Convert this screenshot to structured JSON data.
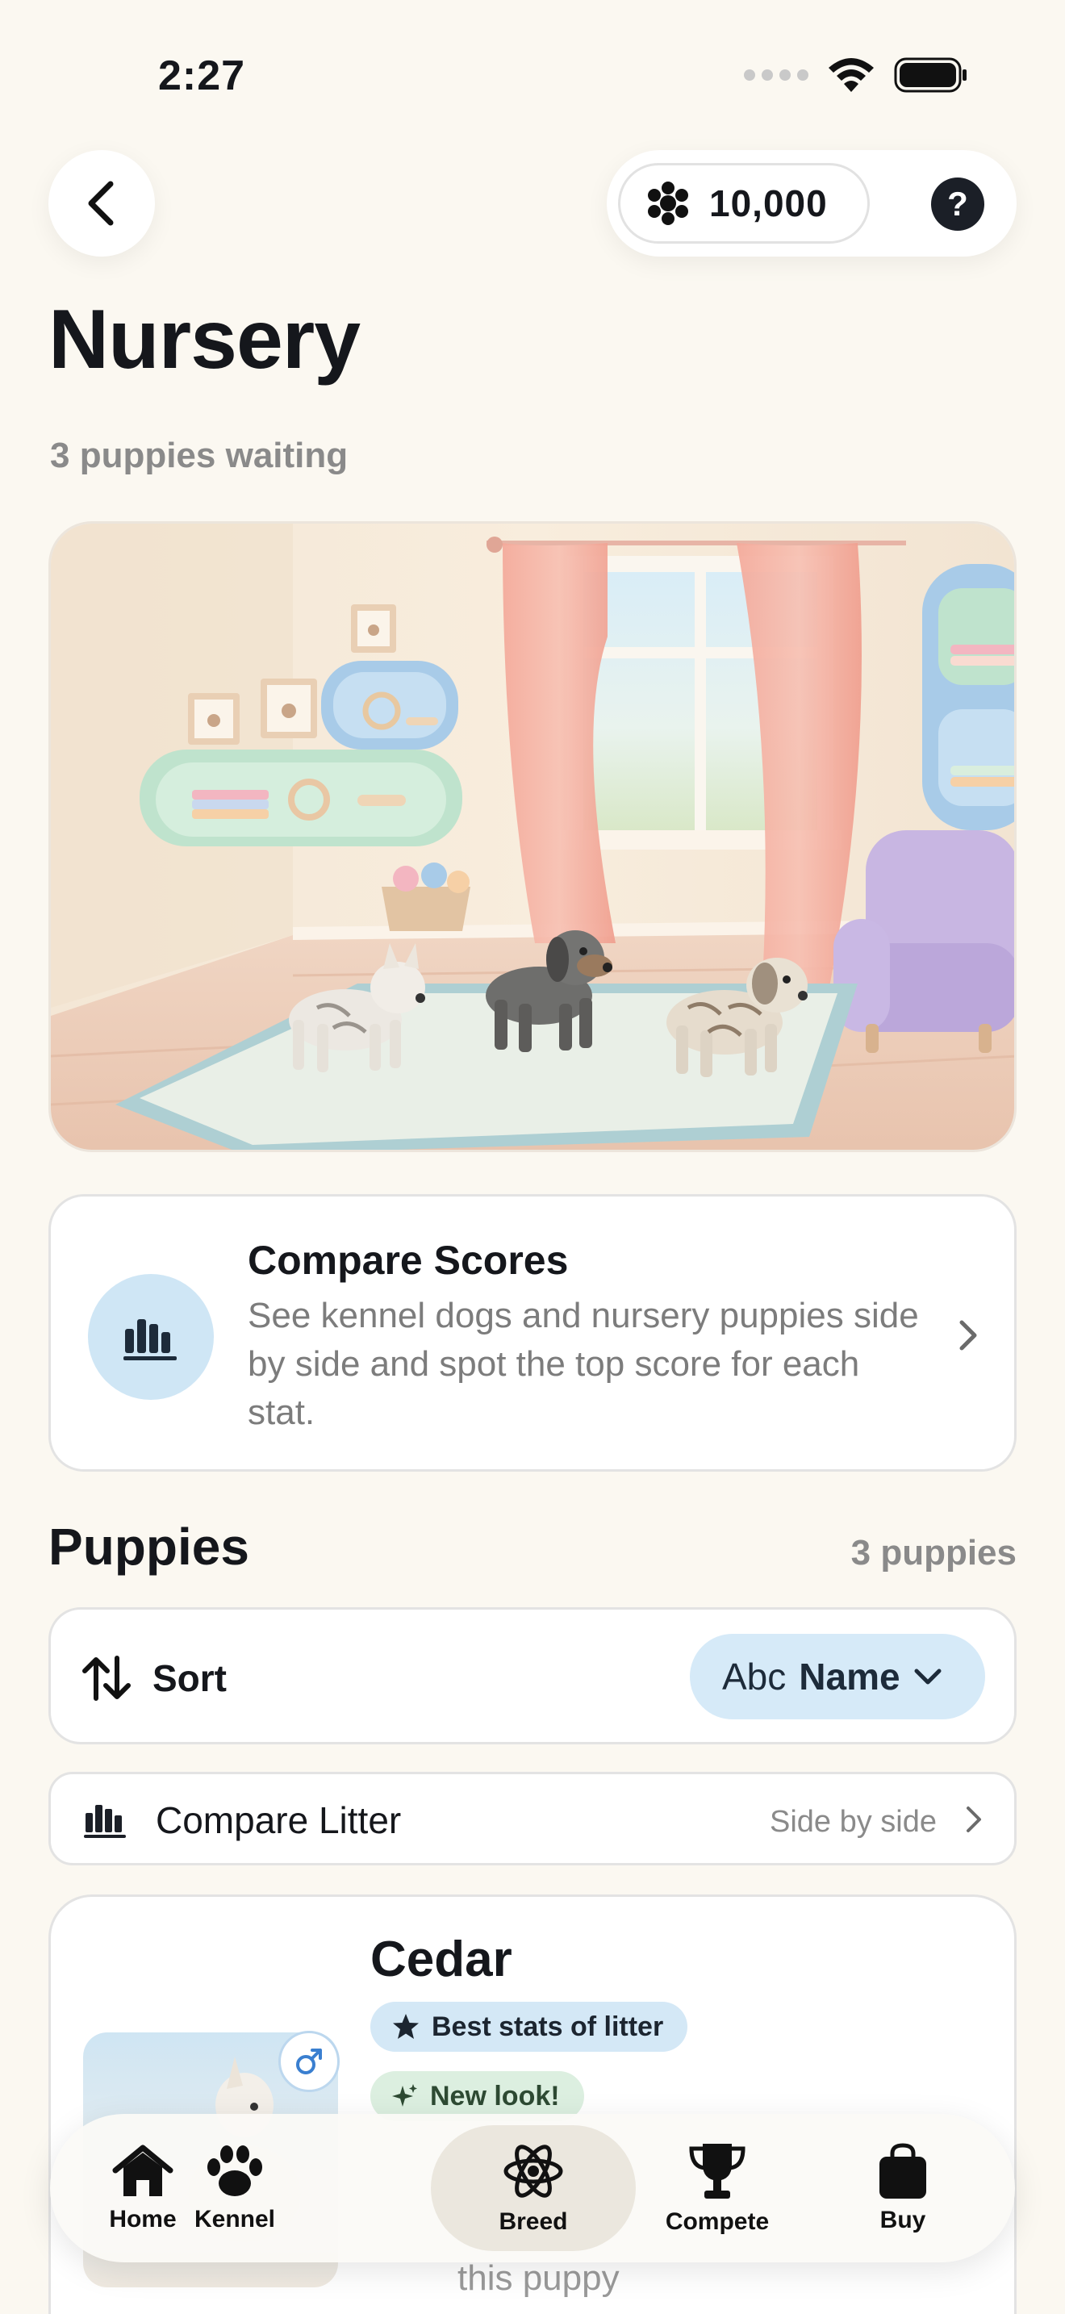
{
  "status_bar": {
    "time": "2:27"
  },
  "header": {
    "coins": "10,000",
    "help_label": "?"
  },
  "page": {
    "title": "Nursery",
    "subtitle": "3 puppies waiting"
  },
  "compare_scores": {
    "title": "Compare Scores",
    "description": "See kennel dogs and nursery puppies side by side and spot the top score for each stat."
  },
  "puppies_section": {
    "title": "Puppies",
    "count": "3 puppies"
  },
  "sort": {
    "label": "Sort",
    "prefix": "Abc",
    "value": "Name"
  },
  "compare_litter": {
    "label": "Compare Litter",
    "note": "Side by side"
  },
  "puppy_card": {
    "name": "Cedar",
    "badge_best": "Best stats of litter",
    "badge_new": "New look!",
    "footer_text": "this puppy"
  },
  "tabbar": {
    "items": [
      {
        "label": "Home",
        "icon": "house-icon"
      },
      {
        "label": "Kennel",
        "icon": "paw-icon"
      },
      {
        "label": "Breed",
        "icon": "atom-icon"
      },
      {
        "label": "Compete",
        "icon": "trophy-icon"
      },
      {
        "label": "Buy",
        "icon": "shopping-bag-icon"
      }
    ],
    "active": "Breed"
  },
  "colors": {
    "background": "#fbf8f1",
    "accent_blue": "#d6eaf8",
    "badge_green": "#dcefe0",
    "text_primary": "#15171c",
    "text_secondary": "#8a8a8a"
  }
}
